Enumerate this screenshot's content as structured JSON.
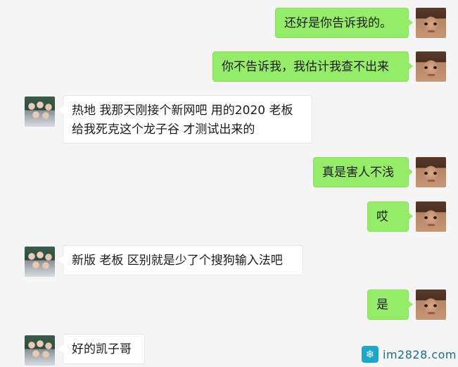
{
  "messages": [
    {
      "side": "right",
      "text": "还好是你告诉我的。"
    },
    {
      "side": "right",
      "text": "你不告诉我，我估计我查不出来"
    },
    {
      "side": "left",
      "text": "热地 我那天刚接个新网吧 用的2020 老板\n给我死克这个龙子谷 才测试出来的"
    },
    {
      "side": "right",
      "text": "真是害人不浅"
    },
    {
      "side": "right",
      "text": "哎"
    },
    {
      "side": "left",
      "text": "新版 老板 区别就是少了个搜狗输入法吧"
    },
    {
      "side": "right",
      "text": "是"
    },
    {
      "side": "left",
      "text": "好的凯子哥"
    }
  ],
  "watermark": {
    "text": "im2828.com",
    "icon": "snowflake-icon"
  },
  "colors": {
    "self_bubble": "#95ec69",
    "other_bubble": "#ffffff",
    "background": "#f5f5f5"
  }
}
